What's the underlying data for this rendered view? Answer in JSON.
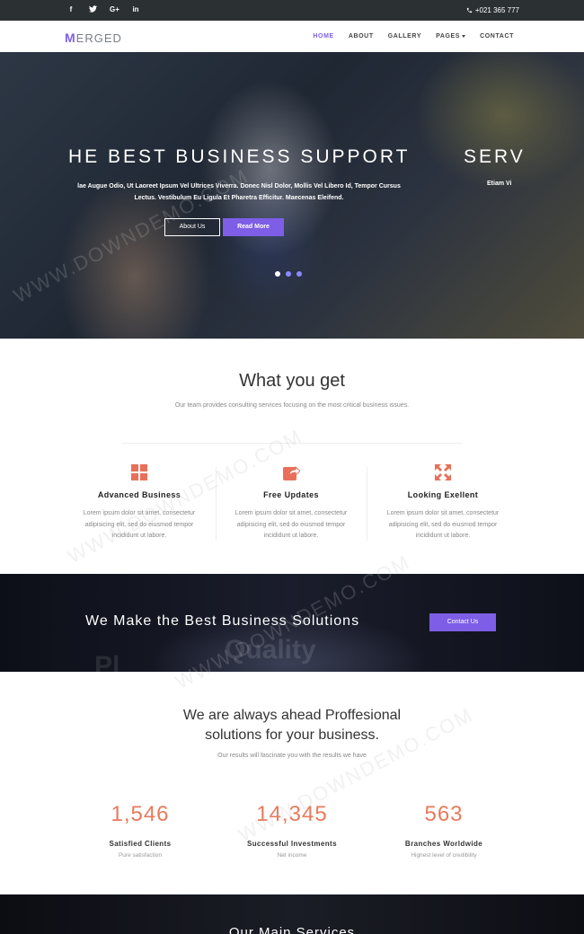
{
  "topbar": {
    "social": [
      "f",
      "t",
      "G+",
      "in"
    ],
    "social_icons": [
      "facebook-icon",
      "twitter-icon",
      "google-plus-icon",
      "linkedin-icon"
    ],
    "phone": "+021 365 777"
  },
  "navbar": {
    "logo_first": "M",
    "logo_rest": "ERGED",
    "menu": [
      {
        "label": "HOME",
        "active": true
      },
      {
        "label": "ABOUT"
      },
      {
        "label": "GALLERY"
      },
      {
        "label": "PAGES"
      },
      {
        "label": "CONTACT"
      }
    ]
  },
  "hero": {
    "title": "HE BEST BUSINESS SUPPORT",
    "title_next": "SERV",
    "text": "lae Augue Odio, Ut Laoreet Ipsum Vel Ultrices Viverra. Donec Nisl Dolor, Mollis Vel Libero Id, Tempor Cursus Lectus. Vestibulum Eu Ligula Et Pharetra Efficitur. Maecenas Eleifend.",
    "text_next": "Etiam Vi",
    "btn_about": "About Us",
    "btn_more": "Read More",
    "slides": 3,
    "active_slide": 1
  },
  "what_you_get": {
    "title": "What you get",
    "subtitle": "Our team provides consulting services focusing on the most critical business issues.",
    "features": [
      {
        "icon": "grid-icon",
        "title": "Advanced Business",
        "text": "Lorem ipsum dolor sit amet, consectetur adipisicing elit, sed do eiusmod tempor incididunt ut labore."
      },
      {
        "icon": "share-icon",
        "title": "Free Updates",
        "text": "Lorem ipsum dolor sit amet, consectetur adipisicing elit, sed do eiusmod tempor incididunt ut labore."
      },
      {
        "icon": "expand-icon",
        "title": "Looking Exellent",
        "text": "Lorem ipsum dolor sit amet, consectetur adipisicing elit, sed do eiusmod tempor incididunt ut labore."
      }
    ]
  },
  "cta": {
    "title": "We Make the Best Business Solutions",
    "button": "Contact Us",
    "ghost_text": "Quality",
    "ghost_text2": "Pl"
  },
  "ahead": {
    "title_line1": "We are always ahead Proffesional",
    "title_line2": "solutions for your business.",
    "subtitle": "Our results will fascinate you with the results we have",
    "stats": [
      {
        "number": "1,546",
        "label": "Satisfied Clients",
        "sub": "Pure satisfaction"
      },
      {
        "number": "14,345",
        "label": "Successful Investments",
        "sub": "Net income"
      },
      {
        "number": "563",
        "label": "Branches Worldwide",
        "sub": "Highest level of credibility"
      }
    ]
  },
  "services": {
    "title": "Our Main Services"
  },
  "watermark": "WWW.DOWNDEMO.COM",
  "colors": {
    "accent": "#7e5ee6",
    "stat": "#e87a5b",
    "feature_icon": "#e8705a",
    "topbar": "#2b3032"
  }
}
